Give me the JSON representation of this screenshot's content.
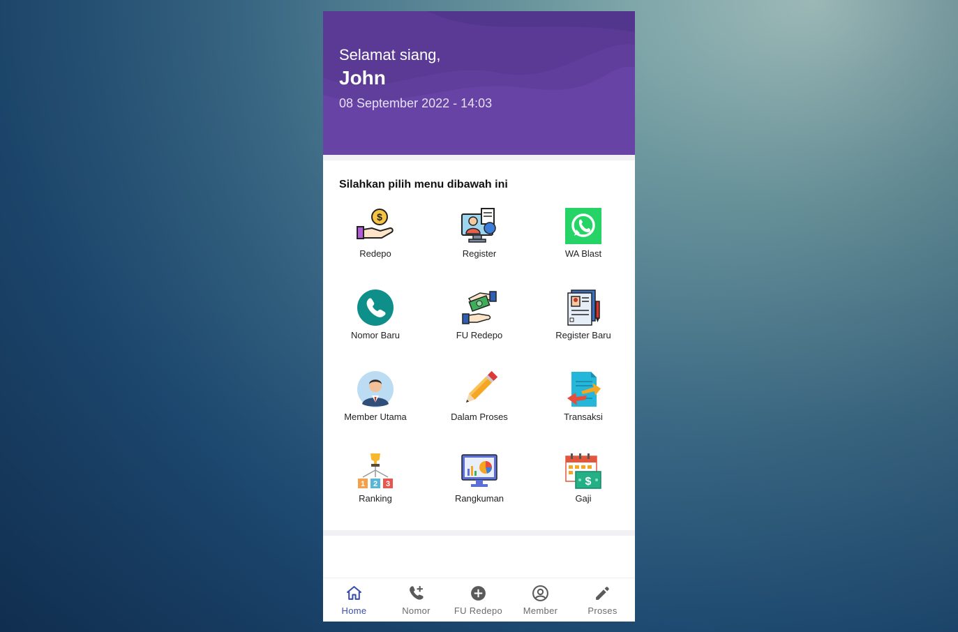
{
  "header": {
    "greeting": "Selamat siang,",
    "user_name": "John",
    "datetime": "08 September 2022 - 14:03"
  },
  "menu": {
    "title": "Silahkan pilih menu dibawah ini",
    "items": [
      {
        "label": "Redepo",
        "icon": "hand-coin-icon"
      },
      {
        "label": "Register",
        "icon": "computer-agent-icon"
      },
      {
        "label": "WA Blast",
        "icon": "whatsapp-icon"
      },
      {
        "label": "Nomor Baru",
        "icon": "phone-icon"
      },
      {
        "label": "FU Redepo",
        "icon": "money-exchange-icon"
      },
      {
        "label": "Register Baru",
        "icon": "document-id-icon"
      },
      {
        "label": "Member Utama",
        "icon": "user-avatar-icon"
      },
      {
        "label": "Dalam Proses",
        "icon": "pencil-icon"
      },
      {
        "label": "Transaksi",
        "icon": "transfer-document-icon"
      },
      {
        "label": "Ranking",
        "icon": "trophy-ranking-icon"
      },
      {
        "label": "Rangkuman",
        "icon": "dashboard-monitor-icon"
      },
      {
        "label": "Gaji",
        "icon": "calendar-salary-icon"
      }
    ]
  },
  "bottom_nav": {
    "tabs": [
      {
        "label": "Home",
        "icon": "home-icon",
        "active": true
      },
      {
        "label": "Nomor",
        "icon": "phone-add-icon",
        "active": false
      },
      {
        "label": "FU Redepo",
        "icon": "add-circle-icon",
        "active": false
      },
      {
        "label": "Member",
        "icon": "account-circle-icon",
        "active": false
      },
      {
        "label": "Proses",
        "icon": "pencil-icon",
        "active": false
      }
    ]
  },
  "colors": {
    "header_bg": "#5a3a94",
    "active_tab": "#3a4fa6",
    "inactive_tab": "#6b6b6b",
    "whatsapp_green": "#25d366",
    "phone_teal": "#0e8f8a"
  }
}
